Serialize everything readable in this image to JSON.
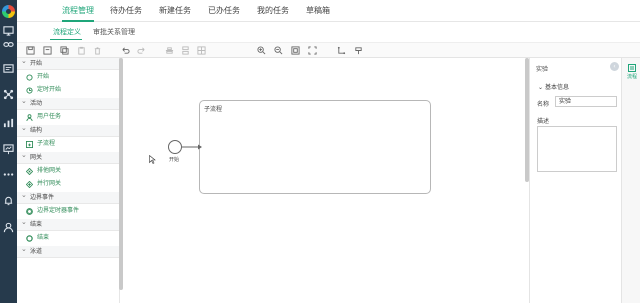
{
  "rail": {
    "icons": [
      "logo",
      "desktop-icon",
      "link-icon",
      "card-icon",
      "network-icon",
      "chart-icon",
      "presentation-icon",
      "more-icon",
      "bell-icon",
      "user-icon"
    ]
  },
  "topnav": {
    "tabs": [
      "流程管理",
      "待办任务",
      "新建任务",
      "已办任务",
      "我的任务",
      "草稿箱"
    ],
    "active_index": 0
  },
  "subnav": {
    "tabs": [
      "流程定义",
      "审批关系管理"
    ],
    "active_index": 0
  },
  "palette": {
    "categories": [
      {
        "label": "开始",
        "items": [
          "开始",
          "定时开始"
        ]
      },
      {
        "label": "活动",
        "items": [
          "用户任务"
        ]
      },
      {
        "label": "结构",
        "items": [
          "子流程"
        ]
      },
      {
        "label": "网关",
        "items": [
          "排他网关",
          "并行网关"
        ]
      },
      {
        "label": "边界事件",
        "items": [
          "边界定时器事件"
        ]
      },
      {
        "label": "结束",
        "items": [
          "结束"
        ]
      },
      {
        "label": "泳道",
        "items": []
      }
    ]
  },
  "canvas": {
    "subprocess_label": "子流程",
    "start_label": "开始"
  },
  "properties": {
    "title": "实验",
    "section": "基本信息",
    "name_label": "名称",
    "name_value": "实验",
    "desc_label": "描述"
  },
  "sidetab": {
    "label": "流程"
  },
  "colors": {
    "accent": "#1fa67a",
    "rail_bg": "#263a4c"
  }
}
